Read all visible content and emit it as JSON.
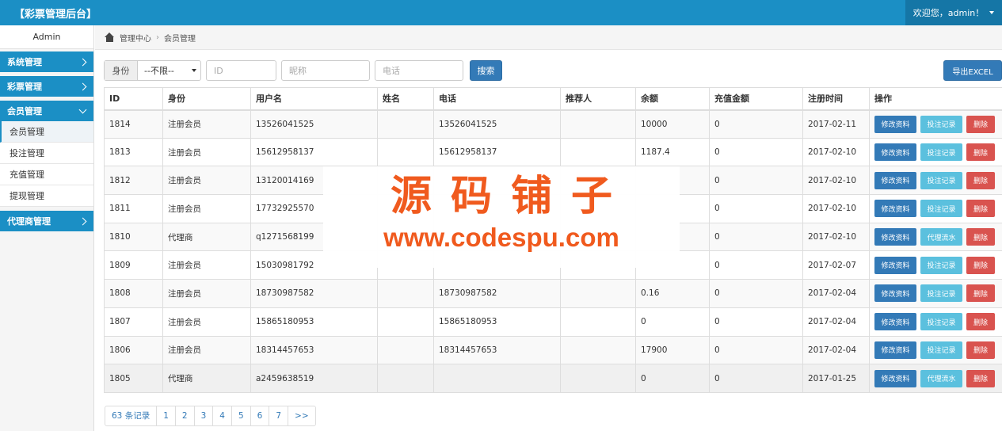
{
  "header": {
    "title": "【彩票管理后台】",
    "welcome": "欢迎您，admin！"
  },
  "sidebar": {
    "user": "Admin",
    "groups": [
      {
        "label": "系统管理"
      },
      {
        "label": "彩票管理"
      },
      {
        "label": "会员管理",
        "items": [
          "会员管理",
          "投注管理",
          "充值管理",
          "提现管理"
        ]
      },
      {
        "label": "代理商管理"
      }
    ]
  },
  "breadcrumb": {
    "home": "管理中心",
    "current": "会员管理"
  },
  "search": {
    "role_label": "身份",
    "role_value": "--不限--",
    "id_placeholder": "ID",
    "nickname_placeholder": "昵称",
    "phone_placeholder": "电话",
    "search_button": "搜索",
    "export_button": "导出EXCEL"
  },
  "table": {
    "headers": [
      "ID",
      "身份",
      "用户名",
      "姓名",
      "电话",
      "推荐人",
      "余额",
      "充值金额",
      "注册时间",
      "操作"
    ],
    "rows": [
      {
        "id": "1814",
        "role": "注册会员",
        "username": "13526041525",
        "name": "",
        "phone": "13526041525",
        "referrer": "",
        "balance": "10000",
        "recharge": "0",
        "date": "2017-02-11",
        "op2": "投注记录"
      },
      {
        "id": "1813",
        "role": "注册会员",
        "username": "15612958137",
        "name": "",
        "phone": "15612958137",
        "referrer": "",
        "balance": "1187.4",
        "recharge": "0",
        "date": "2017-02-10",
        "op2": "投注记录"
      },
      {
        "id": "1812",
        "role": "注册会员",
        "username": "13120014169",
        "name": "",
        "phone": "",
        "referrer": "",
        "balance": "",
        "recharge": "0",
        "date": "2017-02-10",
        "op2": "投注记录"
      },
      {
        "id": "1811",
        "role": "注册会员",
        "username": "17732925570",
        "name": "",
        "phone": "",
        "referrer": "",
        "balance": "",
        "recharge": "0",
        "date": "2017-02-10",
        "op2": "投注记录"
      },
      {
        "id": "1810",
        "role": "代理商",
        "username": "q1271568199",
        "name": "",
        "phone": "",
        "referrer": "",
        "balance": "",
        "recharge": "0",
        "date": "2017-02-10",
        "op2": "代理流水"
      },
      {
        "id": "1809",
        "role": "注册会员",
        "username": "15030981792",
        "name": "",
        "phone": "",
        "referrer": "",
        "balance": "",
        "recharge": "0",
        "date": "2017-02-07",
        "op2": "投注记录"
      },
      {
        "id": "1808",
        "role": "注册会员",
        "username": "18730987582",
        "name": "",
        "phone": "18730987582",
        "referrer": "",
        "balance": "0.16",
        "recharge": "0",
        "date": "2017-02-04",
        "op2": "投注记录"
      },
      {
        "id": "1807",
        "role": "注册会员",
        "username": "15865180953",
        "name": "",
        "phone": "15865180953",
        "referrer": "",
        "balance": "0",
        "recharge": "0",
        "date": "2017-02-04",
        "op2": "投注记录"
      },
      {
        "id": "1806",
        "role": "注册会员",
        "username": "18314457653",
        "name": "",
        "phone": "18314457653",
        "referrer": "",
        "balance": "17900",
        "recharge": "0",
        "date": "2017-02-04",
        "op2": "投注记录"
      },
      {
        "id": "1805",
        "role": "代理商",
        "username": "a2459638519",
        "name": "",
        "phone": "",
        "referrer": "",
        "balance": "0",
        "recharge": "0",
        "date": "2017-01-25",
        "op2": "代理流水"
      }
    ],
    "op_edit": "修改资料",
    "op_delete": "删除"
  },
  "pagination": {
    "total": "63 条记录",
    "pages": [
      "1",
      "2",
      "3",
      "4",
      "5",
      "6",
      "7"
    ],
    "next": ">>"
  },
  "watermark": {
    "cn": "源码铺子",
    "url": "www.codespu.com"
  }
}
